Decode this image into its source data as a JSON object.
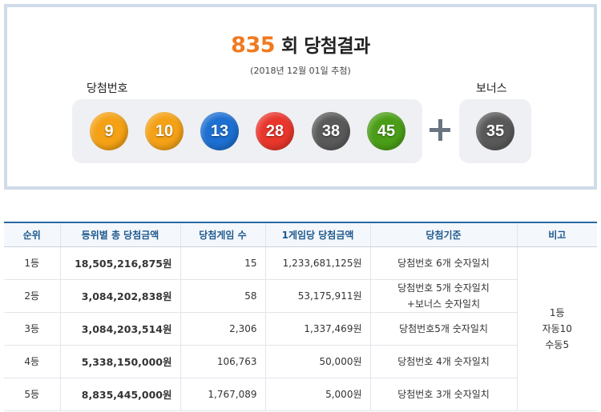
{
  "draw": {
    "round": "835",
    "title_suffix": "회 당첨결과",
    "date": "(2018년 12월 01일 추첨)",
    "label_winning": "당첨번호",
    "label_bonus": "보너스",
    "numbers": [
      {
        "value": "9",
        "color": "#f4a116"
      },
      {
        "value": "10",
        "color": "#f4a116"
      },
      {
        "value": "13",
        "color": "#1d6fd1"
      },
      {
        "value": "28",
        "color": "#e8362c"
      },
      {
        "value": "38",
        "color": "#595959"
      },
      {
        "value": "45",
        "color": "#4a9e17"
      }
    ],
    "bonus": {
      "value": "35",
      "color": "#595959"
    }
  },
  "table": {
    "headers": [
      "순위",
      "등위별 총 당첨금액",
      "당첨게임 수",
      "1게임당 당첨금액",
      "당첨기준",
      "비고"
    ],
    "rows": [
      {
        "rank": "1등",
        "total": "18,505,216,875원",
        "count": "15",
        "per_game": "1,233,681,125원",
        "crit_1": "당첨번호 6개 숫자일치",
        "crit_2": ""
      },
      {
        "rank": "2등",
        "total": "3,084,202,838원",
        "count": "58",
        "per_game": "53,175,911원",
        "crit_1": "당첨번호 5개 숫자일치",
        "crit_2": "+보너스 숫자일치"
      },
      {
        "rank": "3등",
        "total": "3,084,203,514원",
        "count": "2,306",
        "per_game": "1,337,469원",
        "crit_1": "당첨번호5개 숫자일치",
        "crit_2": ""
      },
      {
        "rank": "4등",
        "total": "5,338,150,000원",
        "count": "106,763",
        "per_game": "50,000원",
        "crit_1": "당첨번호 4개 숫자일치",
        "crit_2": ""
      },
      {
        "rank": "5등",
        "total": "8,835,445,000원",
        "count": "1,767,089",
        "per_game": "5,000원",
        "crit_1": "당첨번호 3개 숫자일치",
        "crit_2": ""
      }
    ],
    "note": {
      "line1": "1등",
      "line2": "자동10",
      "line3": "수동5"
    }
  }
}
